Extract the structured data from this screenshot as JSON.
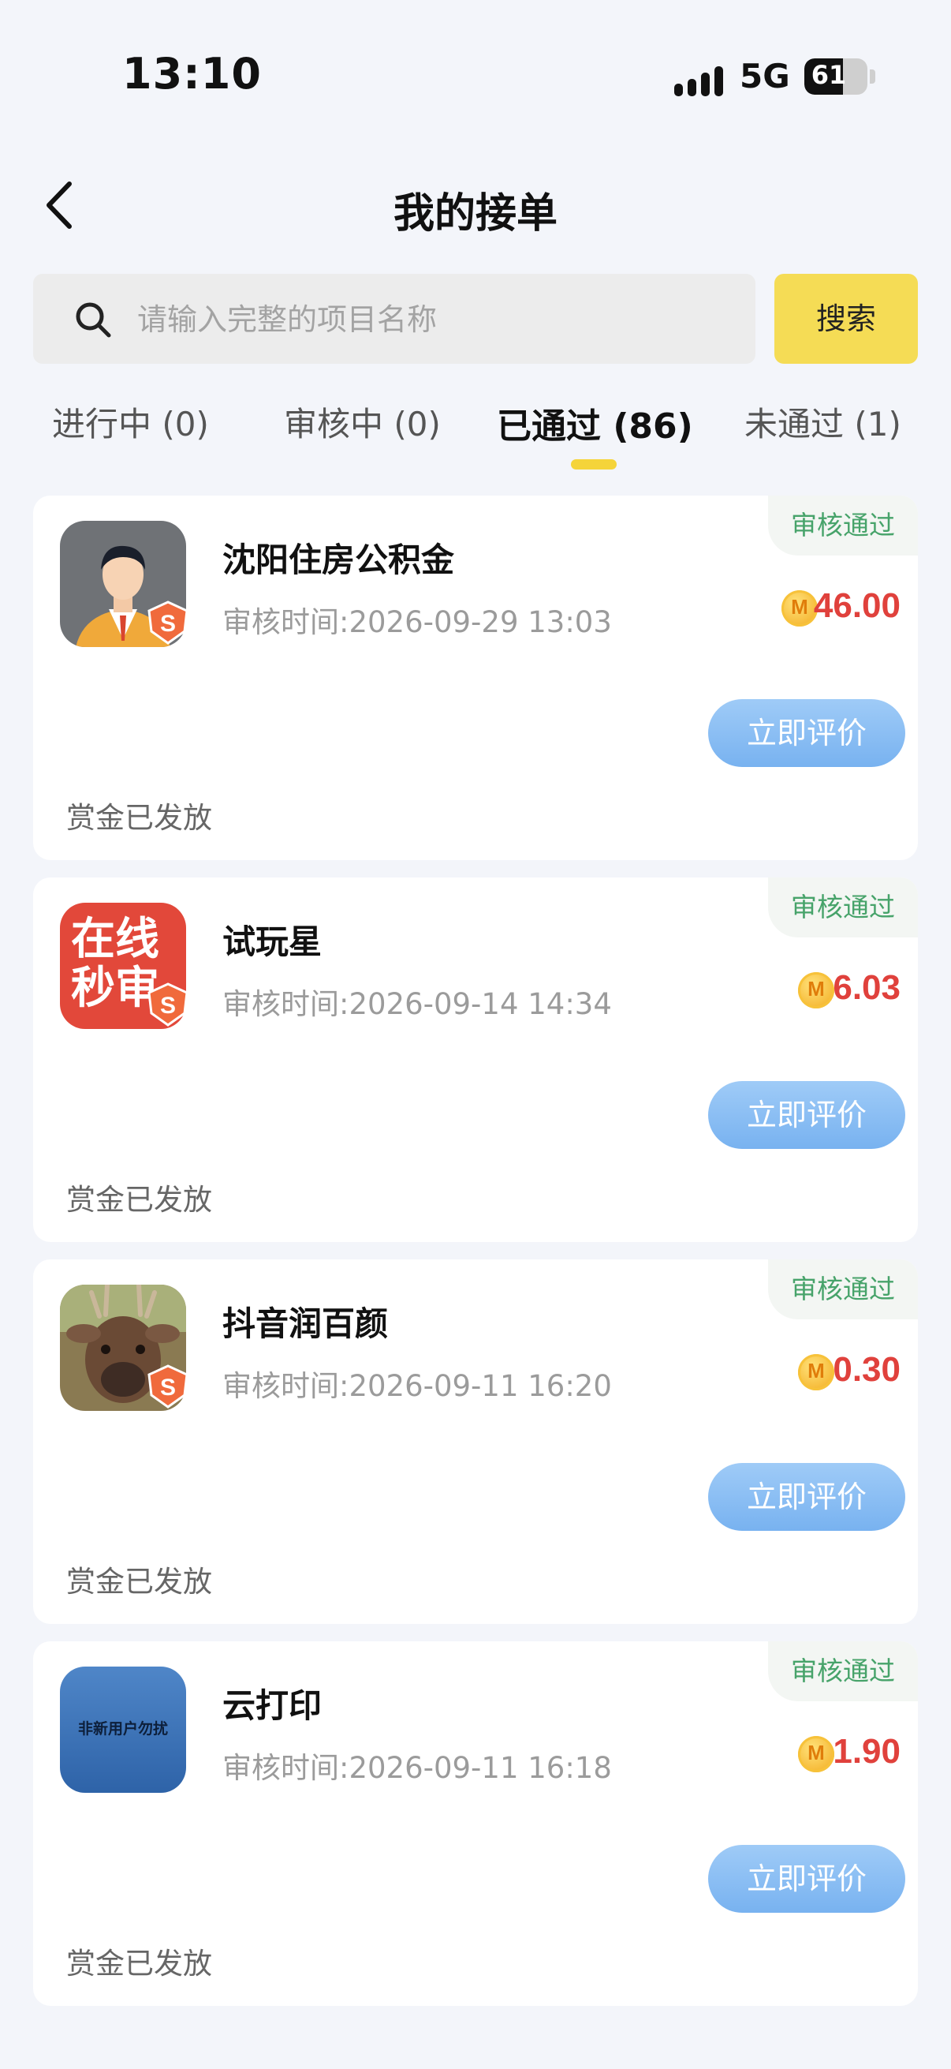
{
  "status_bar": {
    "time": "13:10",
    "network": "5G",
    "battery": "61",
    "battery_level": 0.61
  },
  "header": {
    "title": "我的接单"
  },
  "search": {
    "placeholder": "请输入完整的项目名称",
    "value": "",
    "button_label": "搜索"
  },
  "tabs": [
    {
      "label": "进行中 (0)",
      "active": false
    },
    {
      "label": "审核中 (0)",
      "active": false
    },
    {
      "label": "已通过 (86)",
      "active": true
    },
    {
      "label": "未通过 (1)",
      "active": false
    }
  ],
  "orders": [
    {
      "name": "沈阳住房公积金",
      "status": "审核通过",
      "review_time": "审核时间:2026-09-29 13:03",
      "amount": "46.00",
      "action": "立即评价",
      "bounty_status": "赏金已发放",
      "icon": "person-avatar-icon"
    },
    {
      "name": "试玩星",
      "status": "审核通过",
      "review_time": "审核时间:2026-09-14 14:34",
      "amount": "6.03",
      "action": "立即评价",
      "bounty_status": "赏金已发放",
      "icon": "online-review-logo-icon",
      "icon_text": "在线秒审"
    },
    {
      "name": "抖音润百颜",
      "status": "审核通过",
      "review_time": "审核时间:2026-09-11 16:20",
      "amount": "0.30",
      "action": "立即评价",
      "bounty_status": "赏金已发放",
      "icon": "deer-photo-icon"
    },
    {
      "name": "云打印",
      "status": "审核通过",
      "review_time": "审核时间:2026-09-11 16:18",
      "amount": "1.90",
      "action": "立即评价",
      "bounty_status": "赏金已发放",
      "icon": "cloud-print-logo-icon",
      "icon_text": "非新用户勿扰"
    }
  ],
  "colors": {
    "accent_yellow": "#f5dc55",
    "tab_indicator": "#f5d43a",
    "status_green": "#47a36a",
    "amount_red": "#e0413c",
    "button_blue": "#78b2f0"
  }
}
